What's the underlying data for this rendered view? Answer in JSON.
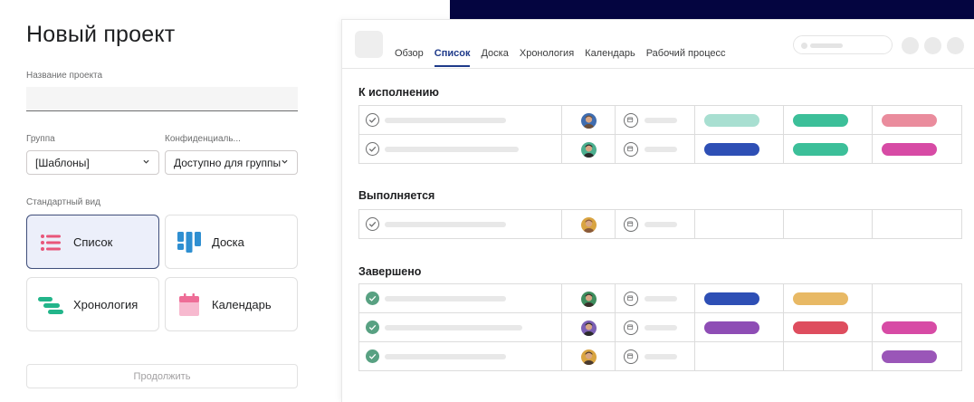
{
  "left": {
    "title": "Новый проект",
    "project_name_label": "Название проекта",
    "project_name_value": "",
    "group_label": "Группа",
    "group_value": "[Шаблоны]",
    "privacy_label": "Конфиденциаль...",
    "privacy_value": "Доступно для группы",
    "default_view_label": "Стандартный вид",
    "views": [
      {
        "label": "Список",
        "icon": "list-icon",
        "selected": true
      },
      {
        "label": "Доска",
        "icon": "board-icon",
        "selected": false
      },
      {
        "label": "Хронология",
        "icon": "timeline-icon",
        "selected": false
      },
      {
        "label": "Календарь",
        "icon": "calendar-icon",
        "selected": false
      }
    ],
    "continue_label": "Продолжить"
  },
  "preview": {
    "tabs": [
      "Обзор",
      "Список",
      "Доска",
      "Хронология",
      "Календарь",
      "Рабочий процесс"
    ],
    "active_tab": "Список",
    "sections": [
      {
        "title": "К исполнению",
        "rows": [
          {
            "done": false,
            "tags": [
              "#a8dfd1",
              "#3cbf99",
              "#ea8c9d"
            ]
          },
          {
            "done": false,
            "tags": [
              "#2e4fb5",
              "#3cbf99",
              "#d74ba5"
            ]
          }
        ]
      },
      {
        "title": "Выполняется",
        "rows": [
          {
            "done": false,
            "tags": [
              "",
              "",
              ""
            ]
          }
        ]
      },
      {
        "title": "Завершено",
        "rows": [
          {
            "done": true,
            "tags": [
              "#2e4fb5",
              "#e8b965",
              ""
            ]
          },
          {
            "done": true,
            "tags": [
              "#8e4db5",
              "#de4d5e",
              "#d74ba5"
            ]
          },
          {
            "done": true,
            "tags": [
              "",
              "",
              "#9a56b8"
            ]
          }
        ]
      }
    ]
  },
  "colors": {
    "accent": "#1e3a8a",
    "navy_bar": "#040540",
    "done_check": "#58a182"
  }
}
